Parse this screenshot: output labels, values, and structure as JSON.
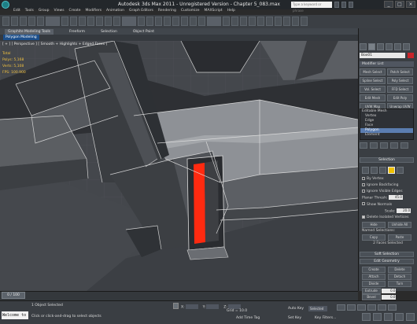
{
  "app": {
    "title": "Autodesk 3ds Max 2011  -  Unregistered Version  -  Chapter 5_083.max",
    "search_placeholder": "Type a keyword or phrase"
  },
  "menu": [
    "Edit",
    "Tools",
    "Group",
    "Views",
    "Create",
    "Modifiers",
    "Animation",
    "Graph Editors",
    "Rendering",
    "Customize",
    "MAXScript",
    "Help"
  ],
  "ribbon": {
    "tabs": [
      "Graphite Modeling Tools",
      "Freeform",
      "Selection",
      "Object Paint"
    ],
    "active_panel": "Polygon Modeling"
  },
  "viewport": {
    "label": "[ + ] [ Perspective ] [ Smooth + Highlights + Edged Faces ]",
    "stats": [
      "Total",
      "Polys:  5,168",
      "Verts:  5,108",
      "FPS:  100.900"
    ],
    "highlight_color": "#ff2a10"
  },
  "command_panel": {
    "object_name": "Box01",
    "object_color": "#c8242a",
    "modifier_list": "Modifier List",
    "modifier_buttons": [
      "Mesh Select",
      "Patch Select",
      "Spline Select",
      "Poly Select",
      "Vol. Select",
      "FFD Select",
      "Edit Mesh",
      "Edit Poly",
      "UVW Map",
      "Unwrap UVW"
    ],
    "stack_title": "Editable Mesh",
    "stack_items": [
      "Vertex",
      "Edge",
      "Face",
      "Polygon",
      "Element"
    ],
    "selected_stack_item": "Polygon",
    "selection_rollout": "Selection",
    "selection_options": [
      "By Vertex",
      "Ignore Backfacing",
      "Ignore Visible Edges"
    ],
    "planar_thresh_label": "Planar Thresh:",
    "planar_thresh_value": "45.0",
    "show_normals": "Show Normals",
    "scale_label": "Scale:",
    "scale_value": "20.0",
    "delete_isolated": "Delete Isolated Vertices",
    "hide_label": "Hide",
    "unhide_label": "Unhide All",
    "named_selections": "Named Selections:",
    "copy_label": "Copy",
    "paste_label": "Paste",
    "faces_selected": "2 Faces Selected",
    "soft_selection": "Soft Selection",
    "edit_geometry": "Edit Geometry",
    "create_label": "Create",
    "delete_label": "Delete",
    "attach_label": "Attach",
    "detach_label": "Detach",
    "divide_label": "Divide",
    "turn_label": "Turn",
    "extrude_label": "Extrude",
    "extrude_value": "0.0",
    "bevel_label": "Bevel",
    "bevel_value": "0.0"
  },
  "timeline": {
    "frame": "0 / 100"
  },
  "status": {
    "maxscript": "Welcome to M",
    "objects_selected": "1 Object Selected",
    "prompt": "Click or click-and-drag to select objects",
    "x_label": "X:",
    "y_label": "Y:",
    "z_label": "Z:",
    "grid": "Grid = 10.0",
    "add_time_tag": "Add Time Tag",
    "auto_key": "Auto Key",
    "set_key": "Set Key",
    "selected_dropdown": "Selected",
    "key_filters": "Key Filters..."
  }
}
